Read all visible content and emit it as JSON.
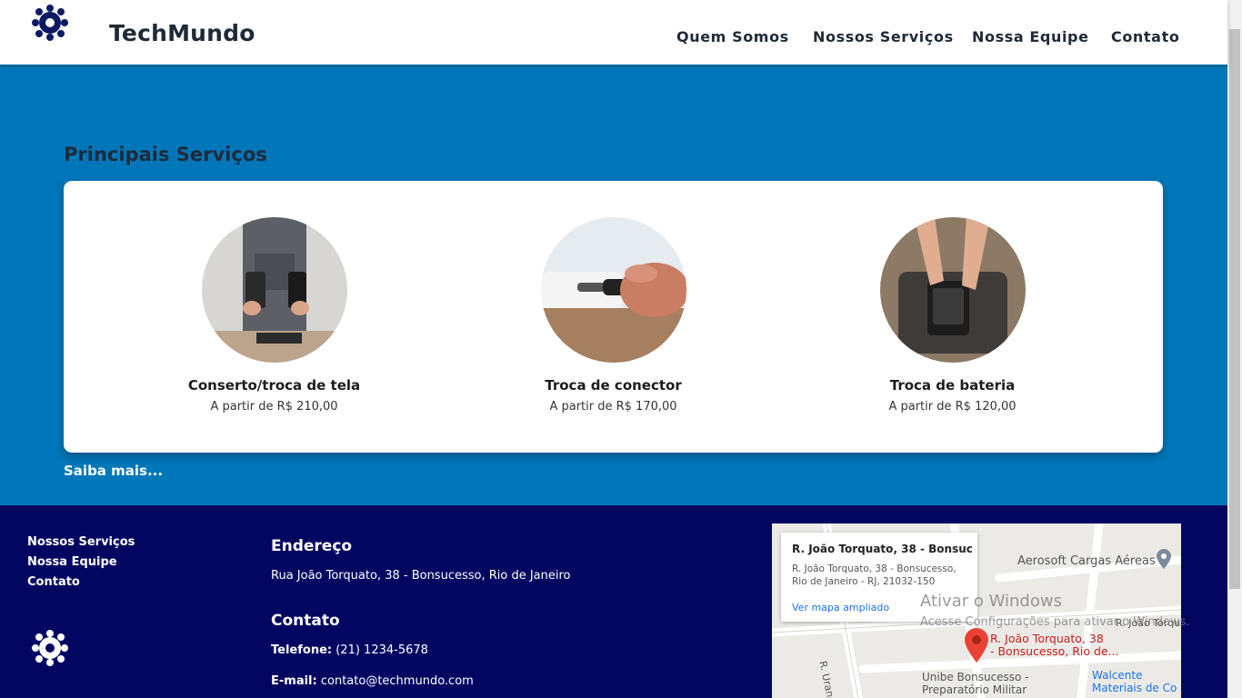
{
  "header": {
    "brand": "TechMundo",
    "nav": [
      "Quem Somos",
      "Nossos Serviços",
      "Nossa Equipe",
      "Contato"
    ]
  },
  "services": {
    "title": "Principais Serviços",
    "items": [
      {
        "name": "Conserto/troca de tela",
        "price": "A partir de R$ 210,00"
      },
      {
        "name": "Troca de conector",
        "price": "A partir de R$ 170,00"
      },
      {
        "name": "Troca de bateria",
        "price": "A partir de R$ 120,00"
      }
    ],
    "more": "Saiba mais..."
  },
  "footer": {
    "links": [
      "Nossos Serviços",
      "Nossa Equipe",
      "Contato"
    ],
    "address_heading": "Endereço",
    "address": "Rua João Torquato, 38 - Bonsucesso, Rio de Janeiro",
    "contact_heading": "Contato",
    "phone_label": "Telefone:",
    "phone": "(21) 1234-5678",
    "email_label": "E-mail:",
    "email": "contato@techmundo.com"
  },
  "map": {
    "popup_title": "R. João Torquato, 38 - Bonsuc...",
    "popup_address_line1": "R. João Torquato, 38 - Bonsucesso,",
    "popup_address_line2": "Rio de Janeiro - RJ, 21032-150",
    "popup_link": "Ver mapa ampliado",
    "place1": "Aerosoft Cargas Aéreas",
    "pin_line1": "R. João Torquato, 38",
    "pin_line2": "- Bonsucesso, Rio de...",
    "street1": "R. Uranos",
    "street2": "R. João Torqu",
    "place2_line1": "Unibe Bonsucesso -",
    "place2_line2": "Preparatório Militar",
    "place3_line1": "Walcente",
    "place3_line2": "Materiais de Co"
  },
  "watermark": {
    "line1": "Ativar o Windows",
    "line2": "Acesse Configurações para ativar o Windows."
  }
}
